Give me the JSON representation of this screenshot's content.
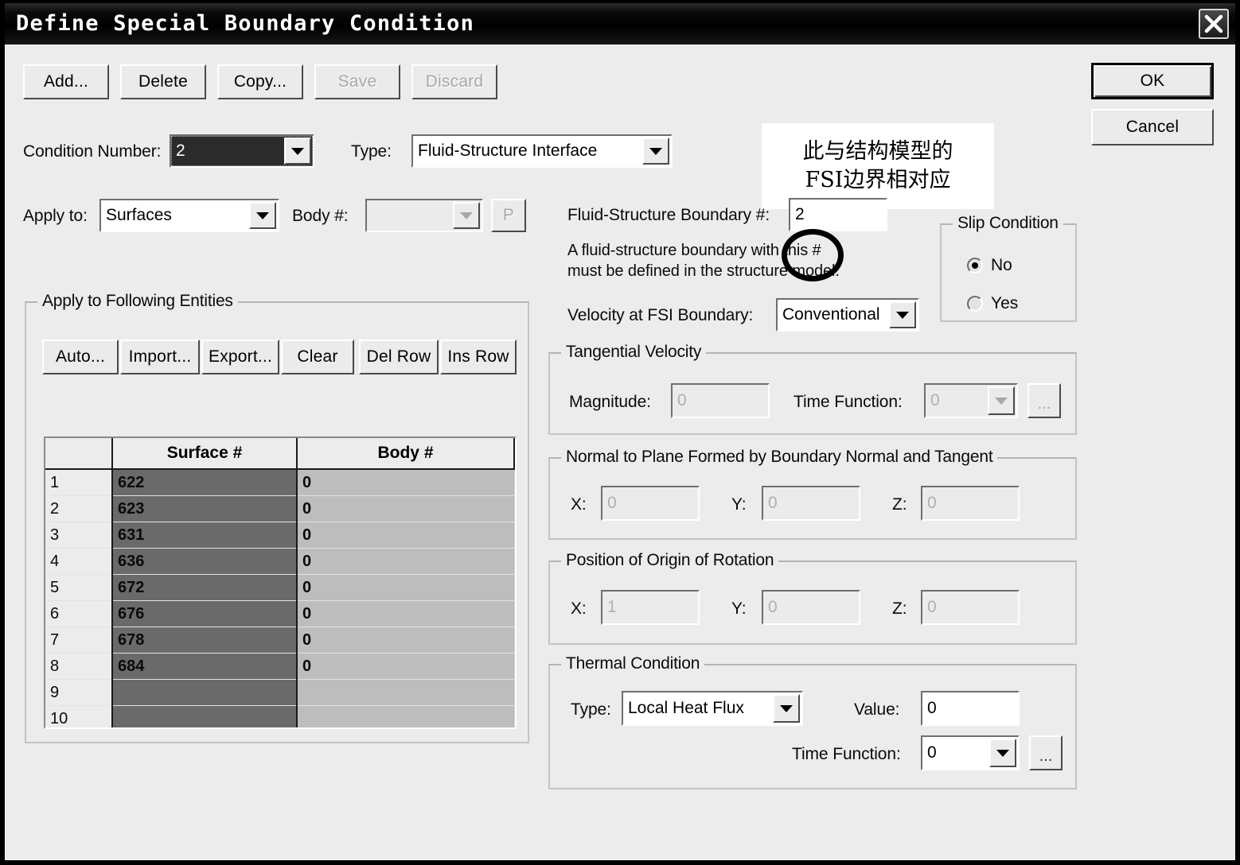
{
  "window": {
    "title": "Define Special Boundary Condition",
    "close_icon": "close-icon"
  },
  "toolbar": {
    "add": "Add...",
    "delete": "Delete",
    "copy": "Copy...",
    "save": "Save",
    "discard": "Discard"
  },
  "dialog_buttons": {
    "ok": "OK",
    "cancel": "Cancel"
  },
  "condition": {
    "number_label": "Condition Number:",
    "number_value": "2",
    "type_label": "Type:",
    "type_value": "Fluid-Structure Interface"
  },
  "apply": {
    "apply_to_label": "Apply to:",
    "apply_to_value": "Surfaces",
    "body_label": "Body #:",
    "body_value": "",
    "p_button": "P"
  },
  "entities": {
    "group_title": "Apply to Following Entities",
    "buttons": {
      "auto": "Auto...",
      "import": "Import...",
      "export": "Export...",
      "clear": "Clear",
      "del_row": "Del Row",
      "ins_row": "Ins Row"
    },
    "columns": [
      "",
      "Surface #",
      "Body #"
    ],
    "rows": [
      {
        "n": "1",
        "surface": "622",
        "body": "0"
      },
      {
        "n": "2",
        "surface": "623",
        "body": "0"
      },
      {
        "n": "3",
        "surface": "631",
        "body": "0"
      },
      {
        "n": "4",
        "surface": "636",
        "body": "0"
      },
      {
        "n": "5",
        "surface": "672",
        "body": "0"
      },
      {
        "n": "6",
        "surface": "676",
        "body": "0"
      },
      {
        "n": "7",
        "surface": "678",
        "body": "0"
      },
      {
        "n": "8",
        "surface": "684",
        "body": "0"
      },
      {
        "n": "9",
        "surface": "",
        "body": ""
      },
      {
        "n": "10",
        "surface": "",
        "body": ""
      }
    ]
  },
  "fsi": {
    "boundary_label": "Fluid-Structure Boundary #:",
    "boundary_value": "2",
    "hint_line1": "A fluid-structure boundary with this #",
    "hint_line2": "must be defined in the structure model.",
    "velocity_label": "Velocity at FSI Boundary:",
    "velocity_value": "Conventional"
  },
  "slip": {
    "group_title": "Slip Condition",
    "option_no": "No",
    "option_yes": "Yes",
    "selected": "No"
  },
  "tangential_velocity": {
    "group_title": "Tangential Velocity",
    "magnitude_label": "Magnitude:",
    "magnitude_value": "0",
    "time_function_label": "Time Function:",
    "time_function_value": "0",
    "browse_label": "..."
  },
  "normal_plane": {
    "group_title": "Normal to Plane Formed by Boundary Normal and Tangent",
    "x_label": "X:",
    "x_value": "0",
    "y_label": "Y:",
    "y_value": "0",
    "z_label": "Z:",
    "z_value": "0"
  },
  "origin_rotation": {
    "group_title": "Position of Origin of Rotation",
    "x_label": "X:",
    "x_value": "1",
    "y_label": "Y:",
    "y_value": "0",
    "z_label": "Z:",
    "z_value": "0"
  },
  "thermal": {
    "group_title": "Thermal Condition",
    "type_label": "Type:",
    "type_value": "Local Heat Flux",
    "value_label": "Value:",
    "value_value": "0",
    "time_function_label": "Time Function:",
    "time_function_value": "0",
    "browse_label": "..."
  },
  "annotation": {
    "line1": "此与结构模型的",
    "line2": "FSI边界相对应"
  },
  "colors": {
    "window_face": "#ececec",
    "titlebar": "#000000",
    "field_bg": "#ffffff",
    "disabled_text": "#a8a8a8",
    "table_surface_cell": "#6a6a6a",
    "table_body_cell": "#bdbdbd"
  }
}
